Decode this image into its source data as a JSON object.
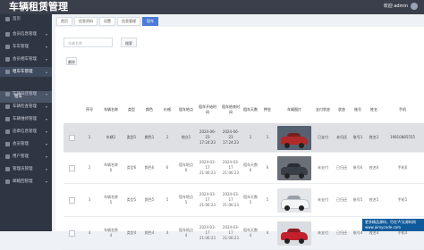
{
  "app": {
    "title": "车辆租赁管理",
    "user": "欢迎 admin"
  },
  "sidebar": {
    "items": [
      {
        "label": "首页"
      },
      {
        "label": "会员信息管理"
      },
      {
        "label": "车车管理"
      },
      {
        "label": "会员相车管理"
      },
      {
        "label": "租车车管理"
      },
      {
        "label": "车辆归还管理"
      },
      {
        "label": "车辆检查管理"
      },
      {
        "label": "车辆维修管理"
      },
      {
        "label": "违章信息管理"
      },
      {
        "label": "会员管理"
      },
      {
        "label": "用户管理"
      },
      {
        "label": "管理员管理"
      },
      {
        "label": "邮箱回管理"
      }
    ],
    "submenu_label": "租车"
  },
  "tabs": [
    "首页",
    "信息资料",
    "设置",
    "信息管理",
    "租车"
  ],
  "search": {
    "placeholder": "车辆名称",
    "button": "搜索"
  },
  "toolbar": {
    "delete": "删除"
  },
  "table": {
    "columns": [
      "序号",
      "车辆名称",
      "类型",
      "颜色",
      "价格",
      "租车地点",
      "租车开始时间",
      "租车结束时间",
      "租车天数",
      "押金",
      "车辆图片",
      "支付状态",
      "状态",
      "账号",
      "姓名",
      "手机"
    ],
    "rows": [
      {
        "index": "1",
        "name": "车辆1",
        "type": "类型1",
        "color": "颜色1",
        "price": "1",
        "location": "地点1",
        "start": "2024-06-23 17:24:23",
        "end": "2024-06-23 17:24:23",
        "days": "1",
        "deposit": "1",
        "pay": "已支付",
        "status": "未归还",
        "account": "账号1",
        "person": "姓名1",
        "phone": "19810885555"
      },
      {
        "index": "2",
        "name": "车辆名称6",
        "type": "类型6",
        "color": "颜色6",
        "price": "6",
        "location": "租车地点6",
        "start": "2024-03-17 21:06:23",
        "end": "2024-03-17 21:06:23",
        "days": "租车天数6",
        "deposit": "6",
        "pay": "未支付",
        "status": "已归还",
        "account": "账号6",
        "person": "姓名6",
        "phone": "手机6"
      },
      {
        "index": "3",
        "name": "车辆名称5",
        "type": "类型5",
        "color": "颜色5",
        "price": "5",
        "location": "租车地点5",
        "start": "2024-03-17 21:06:23",
        "end": "2024-03-17 21:06:23",
        "days": "租车天数5",
        "deposit": "5",
        "pay": "未支付",
        "status": "已归还",
        "account": "账号5",
        "person": "姓名5",
        "phone": "手机5"
      },
      {
        "index": "4",
        "name": "车辆名称4",
        "type": "类型4",
        "color": "颜色4",
        "price": "4",
        "location": "租车地点4",
        "start": "2024-03-17 21:06:23",
        "end": "2024-03-17 21:06:23",
        "days": "租车天数4",
        "deposit": "4",
        "pay": "未支付",
        "status": "已归还",
        "account": "账号4",
        "person": "姓名4",
        "phone": "手机4"
      }
    ]
  },
  "notice": {
    "line1": "更多精品源码，尽在'A'无源码网",
    "line2": "www.aimycode.com"
  },
  "colors": {
    "header": "#3a3f4b",
    "sidebar": "#2f3643",
    "accent": "#4a7bd6",
    "notice": "#0f5a9a"
  }
}
